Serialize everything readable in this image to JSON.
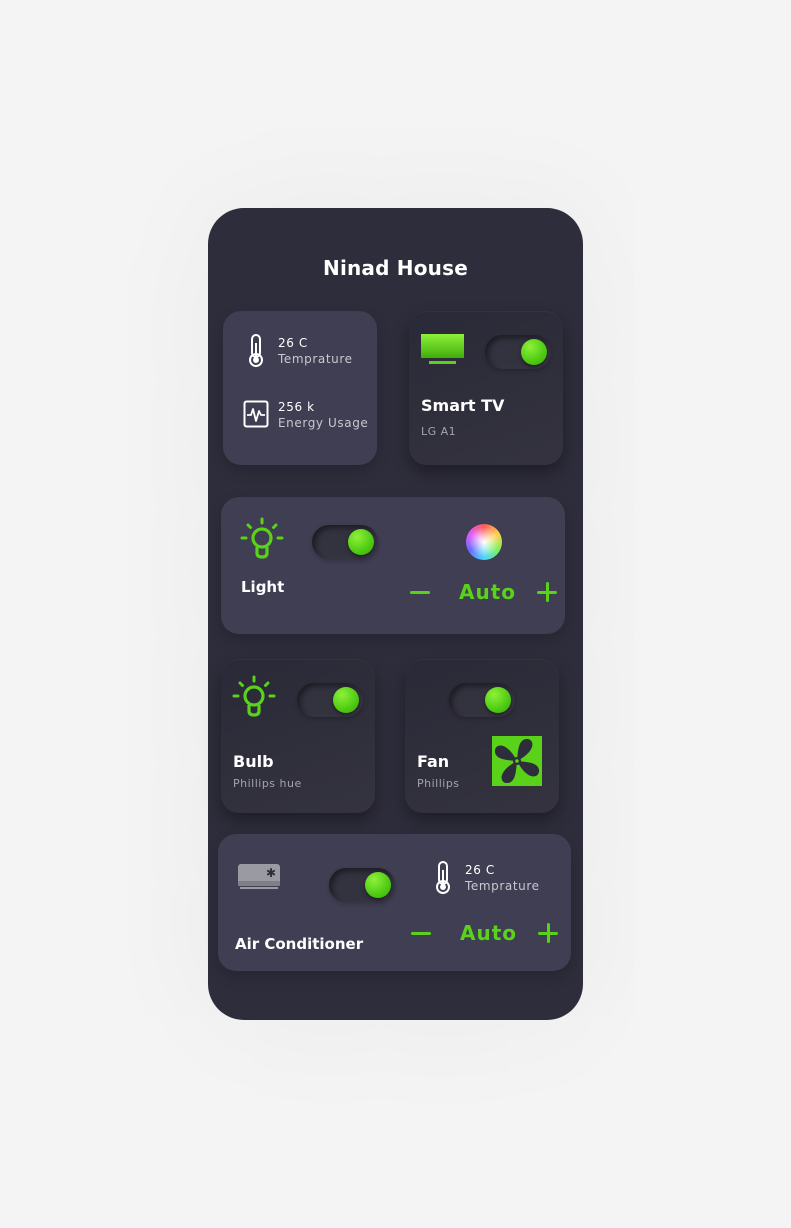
{
  "app": {
    "title": "Ninad House"
  },
  "colors": {
    "accent": "#59d219",
    "background": "#2e2d3b",
    "card": "#3f3e52"
  },
  "stats": {
    "temperature": {
      "value": "26 C",
      "label": "Temprature",
      "icon": "thermometer-icon"
    },
    "energy": {
      "value": "256 k",
      "label": "Energy Usage",
      "icon": "energy-chart-icon"
    }
  },
  "devices": {
    "smart_tv": {
      "name": "Smart TV",
      "model": "LG A1",
      "on": true,
      "icon": "tv-icon"
    },
    "light": {
      "name": "Light",
      "on": true,
      "mode": "Auto",
      "icon": "lightbulb-icon",
      "color_icon": "color-wheel-icon"
    },
    "bulb": {
      "name": "Bulb",
      "model": "Phillips hue",
      "on": true,
      "icon": "lightbulb-icon"
    },
    "fan": {
      "name": "Fan",
      "model": "Phillips",
      "on": true,
      "icon": "fan-icon"
    },
    "ac": {
      "name": "Air Conditioner",
      "on": true,
      "mode": "Auto",
      "icon": "air-conditioner-icon",
      "temperature": {
        "value": "26 C",
        "label": "Temprature"
      }
    }
  }
}
